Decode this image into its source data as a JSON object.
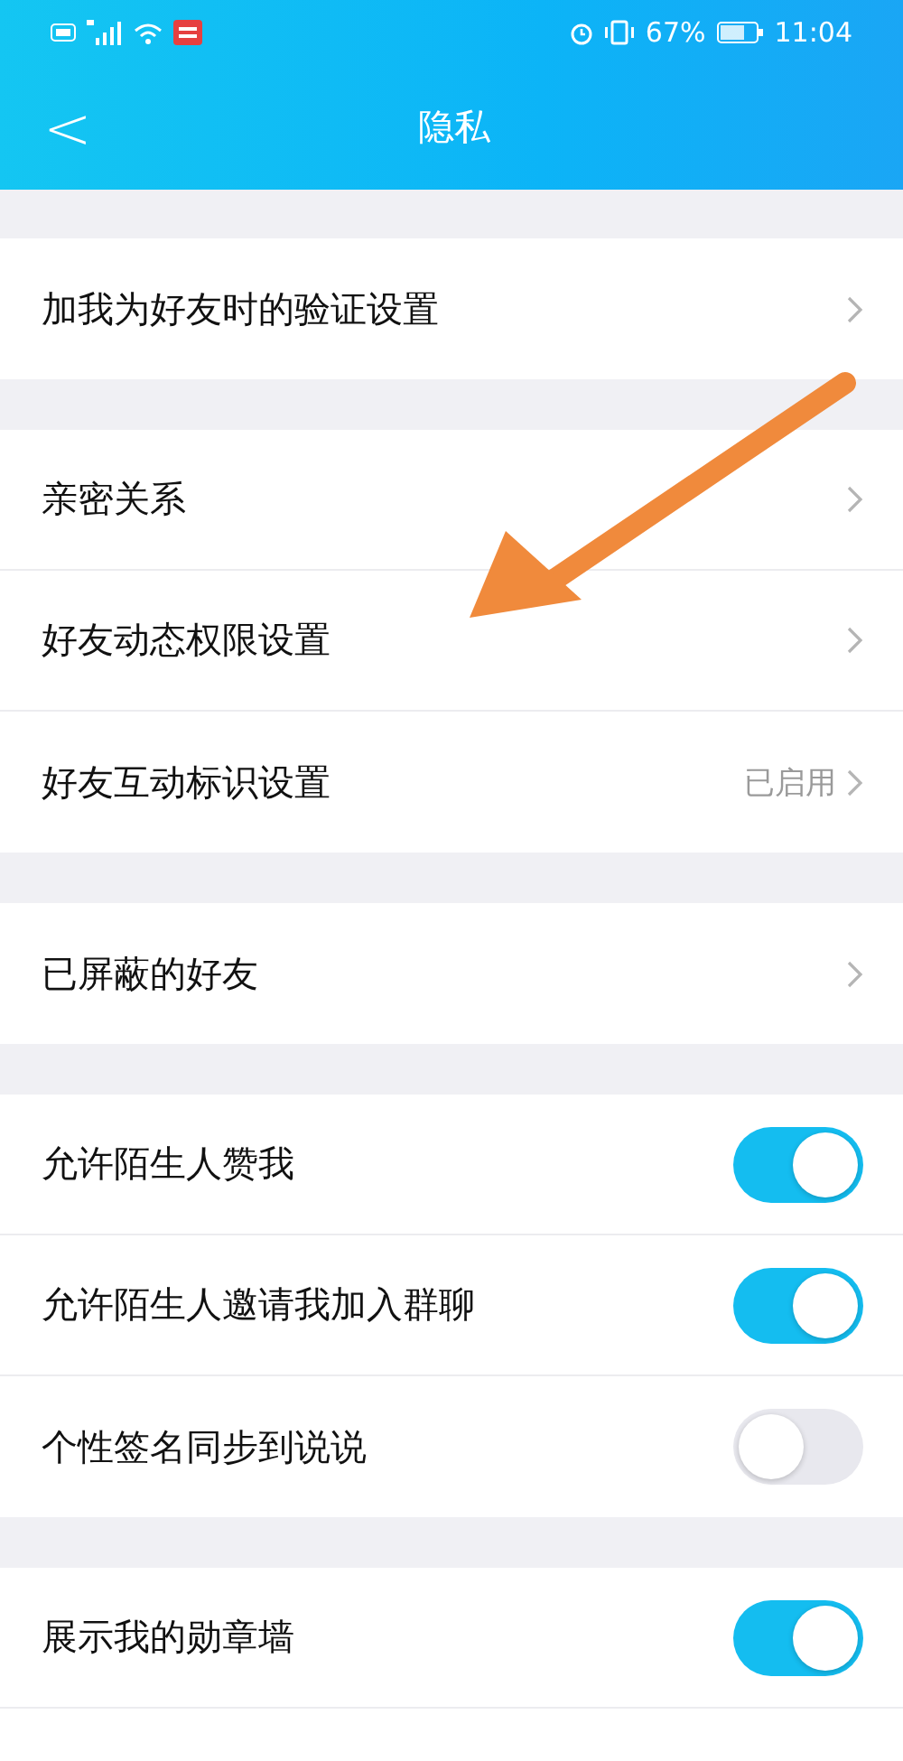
{
  "status_bar": {
    "battery_percent": "67%",
    "time": "11:04"
  },
  "header": {
    "back": "<",
    "title": "隐私"
  },
  "groups": [
    {
      "rows": [
        {
          "kind": "link",
          "label": "加我为好友时的验证设置"
        }
      ]
    },
    {
      "rows": [
        {
          "kind": "link",
          "label": "亲密关系"
        },
        {
          "kind": "link",
          "label": "好友动态权限设置"
        },
        {
          "kind": "link",
          "label": "好友互动标识设置",
          "value": "已启用"
        }
      ]
    },
    {
      "rows": [
        {
          "kind": "link",
          "label": "已屏蔽的好友"
        }
      ]
    },
    {
      "rows": [
        {
          "kind": "toggle",
          "label": "允许陌生人赞我",
          "on": true
        },
        {
          "kind": "toggle",
          "label": "允许陌生人邀请我加入群聊",
          "on": true
        },
        {
          "kind": "toggle",
          "label": "个性签名同步到说说",
          "on": false
        }
      ]
    },
    {
      "rows": [
        {
          "kind": "toggle",
          "label": "展示我的勋章墙",
          "on": true
        },
        {
          "kind": "blank"
        }
      ]
    }
  ],
  "annotation": {
    "kind": "arrow"
  }
}
